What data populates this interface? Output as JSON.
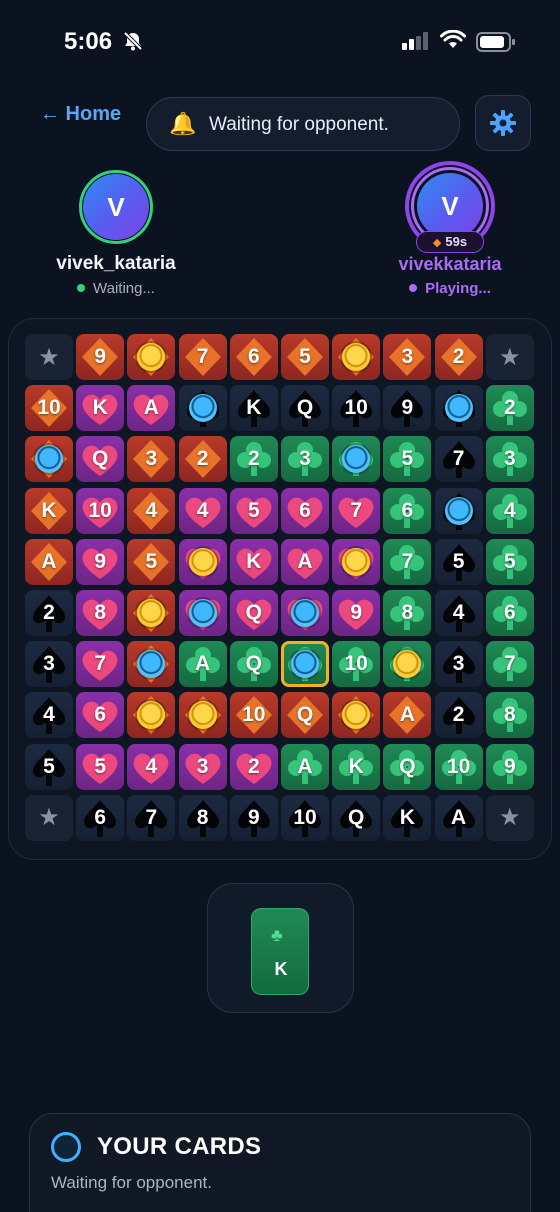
{
  "status_bar": {
    "time": "5:06"
  },
  "top_bar": {
    "home_label": "← Home",
    "status_message": "Waiting for opponent.",
    "status_icon": "bell-icon",
    "settings_icon": "gear-icon"
  },
  "player1": {
    "initial": "V",
    "name": "vivek_kataria",
    "state": "Waiting...",
    "ring_color": "#34d07a"
  },
  "player2": {
    "initial": "V",
    "name": "vivekkataria",
    "state": "Playing...",
    "timer": "59s",
    "ring_color": "#8e45ea"
  },
  "board": {
    "rows": [
      [
        {
          "t": "corner",
          "r": ""
        },
        {
          "t": "diamond",
          "r": "9"
        },
        {
          "t": "diamond",
          "r": "",
          "chip": "gold"
        },
        {
          "t": "diamond",
          "r": "7"
        },
        {
          "t": "diamond",
          "r": "6"
        },
        {
          "t": "diamond",
          "r": "5"
        },
        {
          "t": "diamond",
          "r": "",
          "chip": "gold"
        },
        {
          "t": "diamond",
          "r": "3"
        },
        {
          "t": "diamond",
          "r": "2"
        },
        {
          "t": "corner",
          "r": ""
        }
      ],
      [
        {
          "t": "diamond",
          "r": "10"
        },
        {
          "t": "heart",
          "r": "K"
        },
        {
          "t": "heart",
          "r": "A"
        },
        {
          "t": "spade",
          "r": "",
          "chip": "blue"
        },
        {
          "t": "spade",
          "r": "K"
        },
        {
          "t": "spade",
          "r": "Q"
        },
        {
          "t": "spade",
          "r": "10"
        },
        {
          "t": "spade",
          "r": "9"
        },
        {
          "t": "spade",
          "r": "",
          "chip": "blue"
        },
        {
          "t": "club",
          "r": "2"
        }
      ],
      [
        {
          "t": "diamond",
          "r": "",
          "chip": "blue"
        },
        {
          "t": "heart",
          "r": "Q"
        },
        {
          "t": "diamond",
          "r": "3"
        },
        {
          "t": "diamond",
          "r": "2"
        },
        {
          "t": "club",
          "r": "2"
        },
        {
          "t": "club",
          "r": "3"
        },
        {
          "t": "club",
          "r": "",
          "chip": "blue"
        },
        {
          "t": "club",
          "r": "5"
        },
        {
          "t": "spade",
          "r": "7"
        },
        {
          "t": "club",
          "r": "3"
        }
      ],
      [
        {
          "t": "diamond",
          "r": "K"
        },
        {
          "t": "heart",
          "r": "10"
        },
        {
          "t": "diamond",
          "r": "4"
        },
        {
          "t": "heart",
          "r": "4"
        },
        {
          "t": "heart",
          "r": "5"
        },
        {
          "t": "heart",
          "r": "6"
        },
        {
          "t": "heart",
          "r": "7"
        },
        {
          "t": "club",
          "r": "6"
        },
        {
          "t": "spade",
          "r": "",
          "chip": "blue"
        },
        {
          "t": "club",
          "r": "4"
        }
      ],
      [
        {
          "t": "diamond",
          "r": "A"
        },
        {
          "t": "heart",
          "r": "9"
        },
        {
          "t": "diamond",
          "r": "5"
        },
        {
          "t": "heart",
          "r": "",
          "chip": "gold"
        },
        {
          "t": "heart",
          "r": "K"
        },
        {
          "t": "heart",
          "r": "A"
        },
        {
          "t": "heart",
          "r": "",
          "chip": "gold"
        },
        {
          "t": "club",
          "r": "7"
        },
        {
          "t": "spade",
          "r": "5"
        },
        {
          "t": "club",
          "r": "5"
        }
      ],
      [
        {
          "t": "spade",
          "r": "2"
        },
        {
          "t": "heart",
          "r": "8"
        },
        {
          "t": "diamond",
          "r": "",
          "chip": "gold"
        },
        {
          "t": "heart",
          "r": "",
          "chip": "blue"
        },
        {
          "t": "heart",
          "r": "Q"
        },
        {
          "t": "heart",
          "r": "",
          "chip": "blue"
        },
        {
          "t": "heart",
          "r": "9"
        },
        {
          "t": "club",
          "r": "8"
        },
        {
          "t": "spade",
          "r": "4"
        },
        {
          "t": "club",
          "r": "6"
        }
      ],
      [
        {
          "t": "spade",
          "r": "3"
        },
        {
          "t": "heart",
          "r": "7"
        },
        {
          "t": "diamond",
          "r": "",
          "chip": "blue"
        },
        {
          "t": "club",
          "r": "A"
        },
        {
          "t": "club",
          "r": "Q"
        },
        {
          "t": "club-hl",
          "r": "",
          "chip": "blue"
        },
        {
          "t": "club",
          "r": "10"
        },
        {
          "t": "club",
          "r": "",
          "chip": "gold"
        },
        {
          "t": "spade",
          "r": "3"
        },
        {
          "t": "club",
          "r": "7"
        }
      ],
      [
        {
          "t": "spade",
          "r": "4"
        },
        {
          "t": "heart",
          "r": "6"
        },
        {
          "t": "diamond",
          "r": "",
          "chip": "gold"
        },
        {
          "t": "diamond",
          "r": "",
          "chip": "gold"
        },
        {
          "t": "diamond",
          "r": "10"
        },
        {
          "t": "diamond",
          "r": "Q"
        },
        {
          "t": "diamond",
          "r": "",
          "chip": "gold"
        },
        {
          "t": "diamond",
          "r": "A"
        },
        {
          "t": "spade",
          "r": "2"
        },
        {
          "t": "club",
          "r": "8"
        }
      ],
      [
        {
          "t": "spade",
          "r": "5"
        },
        {
          "t": "heart",
          "r": "5"
        },
        {
          "t": "heart",
          "r": "4"
        },
        {
          "t": "heart",
          "r": "3"
        },
        {
          "t": "heart",
          "r": "2"
        },
        {
          "t": "club",
          "r": "A"
        },
        {
          "t": "club",
          "r": "K"
        },
        {
          "t": "club",
          "r": "Q"
        },
        {
          "t": "club",
          "r": "10"
        },
        {
          "t": "club",
          "r": "9"
        }
      ],
      [
        {
          "t": "corner",
          "r": ""
        },
        {
          "t": "spade",
          "r": "6"
        },
        {
          "t": "spade",
          "r": "7"
        },
        {
          "t": "spade",
          "r": "8"
        },
        {
          "t": "spade",
          "r": "9"
        },
        {
          "t": "spade",
          "r": "10"
        },
        {
          "t": "spade",
          "r": "Q"
        },
        {
          "t": "spade",
          "r": "K"
        },
        {
          "t": "spade",
          "r": "A"
        },
        {
          "t": "corner",
          "r": ""
        }
      ]
    ]
  },
  "current_card": {
    "rank": "K",
    "suit_icon": "club-icon"
  },
  "your_cards": {
    "title": "YOUR CARDS",
    "message": "Waiting for opponent."
  }
}
